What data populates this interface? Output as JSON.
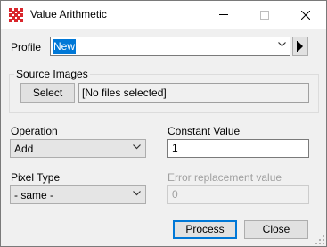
{
  "window": {
    "title": "Value Arithmetic",
    "icon": "red-grid-icon"
  },
  "profile": {
    "label": "Profile",
    "selected": "New"
  },
  "source_images": {
    "group_label": "Source Images",
    "select_button": "Select",
    "files_text": "[No files selected]"
  },
  "operation": {
    "label": "Operation",
    "selected": "Add"
  },
  "constant_value": {
    "label": "Constant Value",
    "value": "1"
  },
  "pixel_type": {
    "label": "Pixel Type",
    "selected": "- same -"
  },
  "error_replacement": {
    "label": "Error replacement value",
    "value": "0",
    "enabled": false
  },
  "buttons": {
    "process": "Process",
    "close": "Close"
  },
  "colors": {
    "accent": "#0078d7",
    "icon_red": "#d9262c"
  }
}
